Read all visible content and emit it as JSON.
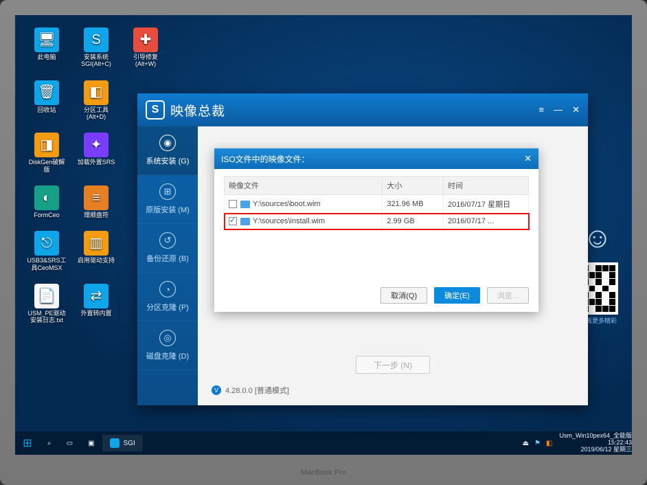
{
  "desktop": {
    "icons": [
      [
        {
          "k": "pc",
          "label": "此电脑"
        },
        {
          "k": "sgi",
          "label": "安装系统\nSGI(Alt+C)"
        },
        {
          "k": "repair",
          "label": "引导修复\n(Alt+W)"
        }
      ],
      [
        {
          "k": "bin",
          "label": "回收站"
        },
        {
          "k": "part",
          "label": "分区工具\n(Alt+D)"
        }
      ],
      [
        {
          "k": "disk",
          "label": "DiskGen破解\n版"
        },
        {
          "k": "srs",
          "label": "加载外置SRS"
        }
      ],
      [
        {
          "k": "ceo",
          "label": "FormCeo"
        },
        {
          "k": "drive",
          "label": "理顺盘符"
        }
      ],
      [
        {
          "k": "usb",
          "label": "USB3&SRS工\n具CeoMSX"
        },
        {
          "k": "msx",
          "label": "启用驱动支持"
        }
      ],
      [
        {
          "k": "txt",
          "label": "USM_PE驱动\n安装日志.txt"
        },
        {
          "k": "ext",
          "label": "外置转内置"
        }
      ]
    ]
  },
  "qr_caption": "关注总裁更多精彩",
  "taskbar": {
    "app": "SGI",
    "sysname": "Usm_Win10pex64_全能版",
    "time": "15:22:43",
    "date": "2019/06/12 星期三"
  },
  "app": {
    "title": "映像总裁",
    "menu": "≡",
    "sidebar": [
      {
        "icon": "◉",
        "label": "系统安装 (G)",
        "active": true
      },
      {
        "icon": "⊞",
        "label": "原版安装 (M)"
      },
      {
        "icon": "↺",
        "label": "备份还原 (B)"
      },
      {
        "icon": "◔",
        "label": "分区克隆 (P)"
      },
      {
        "icon": "◎",
        "label": "磁盘克隆 (D)"
      }
    ],
    "next_label": "下一步 (N)",
    "version": "4.28.0.0 [普通模式]"
  },
  "dialog": {
    "title": "ISO文件中的映像文件：",
    "cols": [
      "映像文件",
      "大小",
      "时间"
    ],
    "rows": [
      {
        "checked": false,
        "path": "Y:\\sources\\boot.wim",
        "size": "321.96 MB",
        "time": "2016/07/17 星期日"
      },
      {
        "checked": true,
        "path": "Y:\\sources\\install.wim",
        "size": "2.99 GB",
        "time": "2016/07/17 ...",
        "sel": true
      }
    ],
    "cancel": "取消(Q)",
    "ok": "确定(E)",
    "open": "浏览..."
  },
  "macbook": "MacBook Pro"
}
